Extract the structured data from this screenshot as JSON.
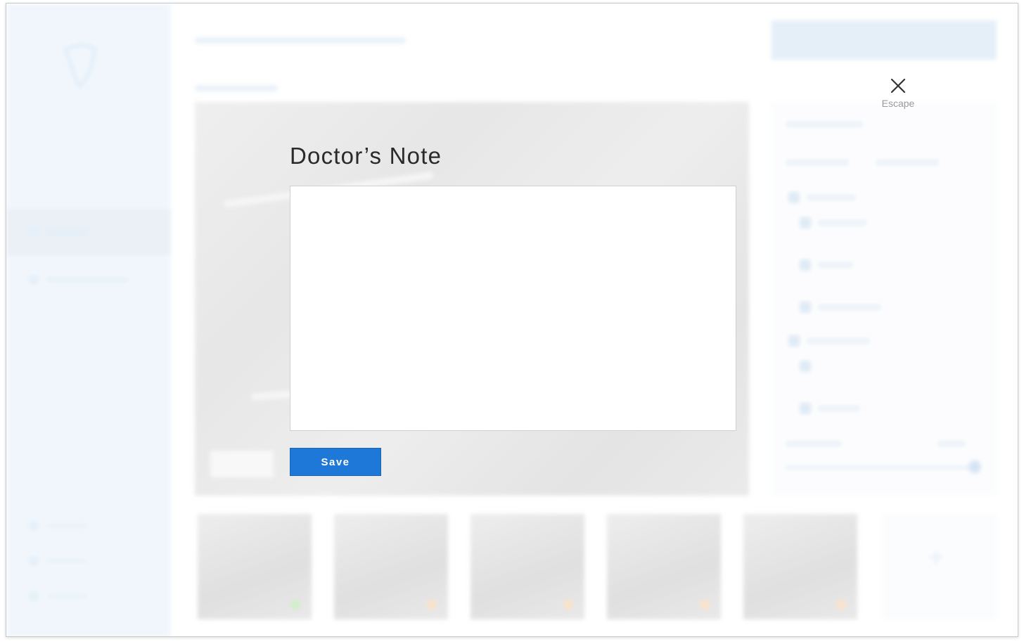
{
  "modal": {
    "title": "Doctor’s Note",
    "note_value": "",
    "note_placeholder": "",
    "save_label": "Save",
    "close_label": "Escape",
    "close_icon": "close-icon"
  },
  "colors": {
    "accent": "#1e78d8",
    "sidebar_bg": "#d8e9f8",
    "escape_text": "#9a9a9a"
  },
  "background": {
    "sidebar_icons": [
      "logo-icon",
      "home-icon",
      "image-icon",
      "settings-icon",
      "help-icon",
      "logout-icon"
    ],
    "thumbnail_status_colors": [
      "#7fd36a",
      "#f5b36b",
      "#f5b36b",
      "#f5b36b",
      "#f5b36b"
    ],
    "add_tile_icon": "plus-icon"
  }
}
